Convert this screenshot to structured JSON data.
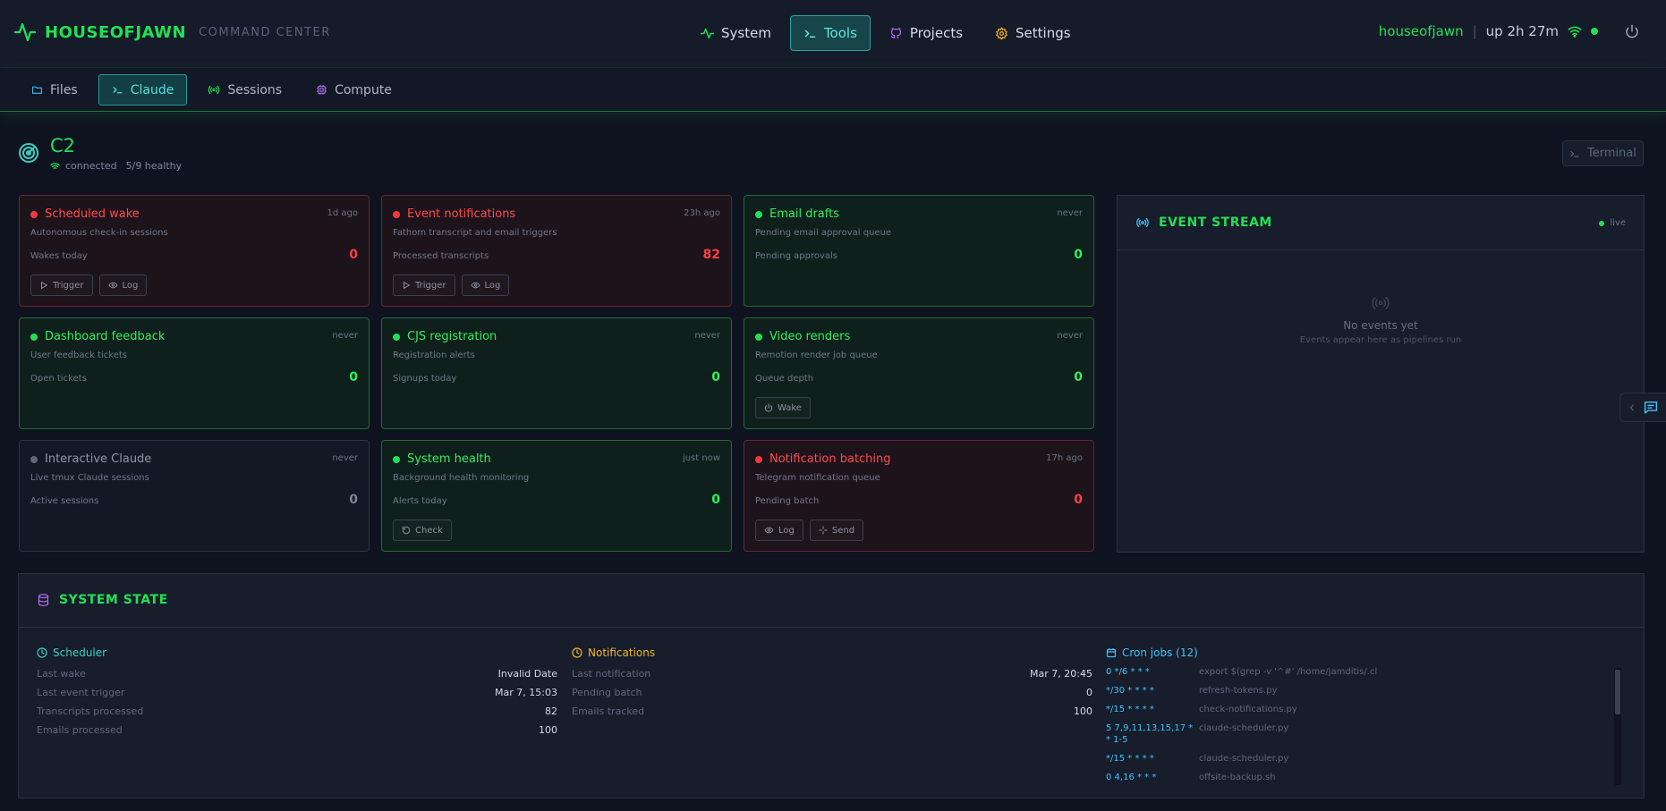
{
  "brand": {
    "name": "HOUSEOFJAWN",
    "subtitle": "COMMAND CENTER"
  },
  "main_nav": [
    {
      "label": "System",
      "icon": "activity-icon",
      "color": "#22e054"
    },
    {
      "label": "Tools",
      "icon": "terminal-icon",
      "color": "#5fe8e0",
      "active": true
    },
    {
      "label": "Projects",
      "icon": "github-icon",
      "color": "#b06cf0"
    },
    {
      "label": "Settings",
      "icon": "gear-icon",
      "color": "#f0b429"
    }
  ],
  "status": {
    "user": "houseofjawn",
    "uptime": "up 2h 27m"
  },
  "sub_nav": [
    {
      "label": "Files",
      "icon": "folder-icon"
    },
    {
      "label": "Claude",
      "icon": "terminal-icon",
      "active": true
    },
    {
      "label": "Sessions",
      "icon": "broadcast-icon"
    },
    {
      "label": "Compute",
      "icon": "cpu-icon"
    }
  ],
  "header": {
    "title": "C2",
    "connection": "connected",
    "health": "5/9 healthy",
    "terminal_label": "Terminal"
  },
  "cards": [
    {
      "name": "Scheduled wake",
      "ago": "1d ago",
      "desc": "Autonomous check-in sessions",
      "metric": "Wakes today",
      "value": "0",
      "state": "red",
      "actions": [
        "Trigger",
        "Log"
      ]
    },
    {
      "name": "Event notifications",
      "ago": "23h ago",
      "desc": "Fathom transcript and email triggers",
      "metric": "Processed transcripts",
      "value": "82",
      "state": "red",
      "actions": [
        "Trigger",
        "Log"
      ]
    },
    {
      "name": "Email drafts",
      "ago": "never",
      "desc": "Pending email approval queue",
      "metric": "Pending approvals",
      "value": "0",
      "state": "green",
      "actions": []
    },
    {
      "name": "Dashboard feedback",
      "ago": "never",
      "desc": "User feedback tickets",
      "metric": "Open tickets",
      "value": "0",
      "state": "green",
      "actions": []
    },
    {
      "name": "CJS registration",
      "ago": "never",
      "desc": "Registration alerts",
      "metric": "Signups today",
      "value": "0",
      "state": "green",
      "actions": []
    },
    {
      "name": "Video renders",
      "ago": "never",
      "desc": "Remotion render job queue",
      "metric": "Queue depth",
      "value": "0",
      "state": "green",
      "actions": [
        "Wake"
      ]
    },
    {
      "name": "Interactive Claude",
      "ago": "never",
      "desc": "Live tmux Claude sessions",
      "metric": "Active sessions",
      "value": "0",
      "state": "gray",
      "actions": []
    },
    {
      "name": "System health",
      "ago": "just now",
      "desc": "Background health monitoring",
      "metric": "Alerts today",
      "value": "0",
      "state": "green",
      "actions": [
        "Check"
      ]
    },
    {
      "name": "Notification batching",
      "ago": "17h ago",
      "desc": "Telegram notification queue",
      "metric": "Pending batch",
      "value": "0",
      "state": "red",
      "actions": [
        "Log",
        "Send"
      ]
    }
  ],
  "event_stream": {
    "title": "EVENT STREAM",
    "live": "live",
    "empty_title": "No events yet",
    "empty_sub": "Events appear here as pipelines run"
  },
  "system_state": {
    "title": "SYSTEM STATE",
    "scheduler": {
      "title": "Scheduler",
      "rows": [
        {
          "k": "Last wake",
          "v": "Invalid Date"
        },
        {
          "k": "Last event trigger",
          "v": "Mar 7, 15:03"
        },
        {
          "k": "Transcripts processed",
          "v": "82"
        },
        {
          "k": "Emails processed",
          "v": "100"
        }
      ]
    },
    "notifications": {
      "title": "Notifications",
      "rows": [
        {
          "k": "Last notification",
          "v": "Mar 7, 20:45"
        },
        {
          "k": "Pending batch",
          "v": "0"
        },
        {
          "k": "Emails tracked",
          "v": "100"
        }
      ]
    },
    "cron": {
      "title": "Cron jobs (12)",
      "rows": [
        {
          "s": "0 */6 * * *",
          "c": "export $(grep -v '^#' /home/jamditis/.cl"
        },
        {
          "s": "*/30 * * * *",
          "c": "refresh-tokens.py"
        },
        {
          "s": "*/15 * * * *",
          "c": "check-notifications.py"
        },
        {
          "s": "5 7,9,11,13,15,17 * * 1-5",
          "c": "claude-scheduler.py"
        },
        {
          "s": "*/15 * * * *",
          "c": "claude-scheduler.py"
        },
        {
          "s": "0 4,16 * * *",
          "c": "offsite-backup.sh"
        }
      ]
    }
  },
  "colors": {
    "accent_green": "#22e054",
    "alert_red": "#ff4a4a",
    "teal": "#5fe8e0",
    "cron_blue": "#3ec3ff",
    "orange": "#f0b429",
    "purple": "#b06cf0"
  }
}
